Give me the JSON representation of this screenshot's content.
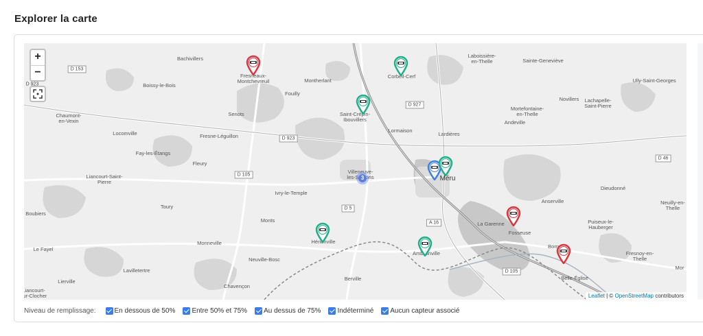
{
  "page": {
    "title": "Explorer la carte"
  },
  "map": {
    "zoom_in": "+",
    "zoom_out": "−",
    "places": [
      {
        "name": "Bachivillers"
      },
      {
        "name": "Fresneaux-\nMontchevreuil"
      },
      {
        "name": "Montherlant"
      },
      {
        "name": "Boissy-le-Bois"
      },
      {
        "name": "Fouilly"
      },
      {
        "name": "Corbeil-Cerf"
      },
      {
        "name": "Laboissière-\nen-Thelle"
      },
      {
        "name": "Sainte-Geneviève"
      },
      {
        "name": "Ully-Saint-Georges"
      },
      {
        "name": "Chaumont-\nen-Vexin"
      },
      {
        "name": "Senots"
      },
      {
        "name": "Saint-Crépin-\nIbouvillers"
      },
      {
        "name": "Novillers"
      },
      {
        "name": "Lachapelle-\nSaint-Pierre"
      },
      {
        "name": "Mortefontaine-\nen-Thelle"
      },
      {
        "name": "Locomville"
      },
      {
        "name": "Fresne-Léguillon"
      },
      {
        "name": "Lormaison"
      },
      {
        "name": "Lardières"
      },
      {
        "name": "Andeville"
      },
      {
        "name": "Fay-les-Étangs"
      },
      {
        "name": "Fleury"
      },
      {
        "name": "Villeneuve-\nles-Sablons"
      },
      {
        "name": "Méru"
      },
      {
        "name": "Liancourt-Saint-\nPierre"
      },
      {
        "name": "Dieudonné"
      },
      {
        "name": "Ivry-le-Temple"
      },
      {
        "name": "Anserville"
      },
      {
        "name": "Neuilly-en-\nThelle"
      },
      {
        "name": "Boubiers"
      },
      {
        "name": "Toury"
      },
      {
        "name": "Monts"
      },
      {
        "name": "La Garenne"
      },
      {
        "name": "Puiseux-le-\nHauberger"
      },
      {
        "name": "Fosseuse"
      },
      {
        "name": "Le Fayel"
      },
      {
        "name": "Monneville"
      },
      {
        "name": "Hénonville"
      },
      {
        "name": "Amblainville"
      },
      {
        "name": "Bornel"
      },
      {
        "name": "Fresnoy-en-\nThelle"
      },
      {
        "name": "Neuville-Bosc"
      },
      {
        "name": "Lavilletertre"
      },
      {
        "name": "Belle-Église"
      },
      {
        "name": "Lierville"
      },
      {
        "name": "Chavençon"
      },
      {
        "name": "Berville"
      },
      {
        "name": "Liancourt-\nsur-Clocher"
      },
      {
        "name": "Mor"
      }
    ],
    "roads": [
      "D 153",
      "D 923",
      "D 927",
      "D 923",
      "D 105",
      "D 5",
      "A 16",
      "D 46",
      "D 105"
    ],
    "cluster_count": "3",
    "markers": [
      {
        "status": "red"
      },
      {
        "status": "green"
      },
      {
        "status": "green"
      },
      {
        "status": "blue"
      },
      {
        "status": "green"
      },
      {
        "status": "red"
      },
      {
        "status": "green"
      },
      {
        "status": "green"
      },
      {
        "status": "red"
      }
    ],
    "colors": {
      "red": "#d9353f",
      "green": "#1fae87",
      "blue": "#3f7fe0"
    },
    "attribution": {
      "leaflet": "Leaflet",
      "sep": " | © ",
      "osm": "OpenStreetMap",
      "suffix": " contributors"
    }
  },
  "legend": {
    "label": "Niveau de remplissage:",
    "items": [
      {
        "label": "En dessous de 50%",
        "checked": true
      },
      {
        "label": "Entre 50% et 75%",
        "checked": true
      },
      {
        "label": "Au dessus de 75%",
        "checked": true
      },
      {
        "label": "Indéterminé",
        "checked": true
      },
      {
        "label": "Aucun capteur associé",
        "checked": true
      }
    ]
  }
}
